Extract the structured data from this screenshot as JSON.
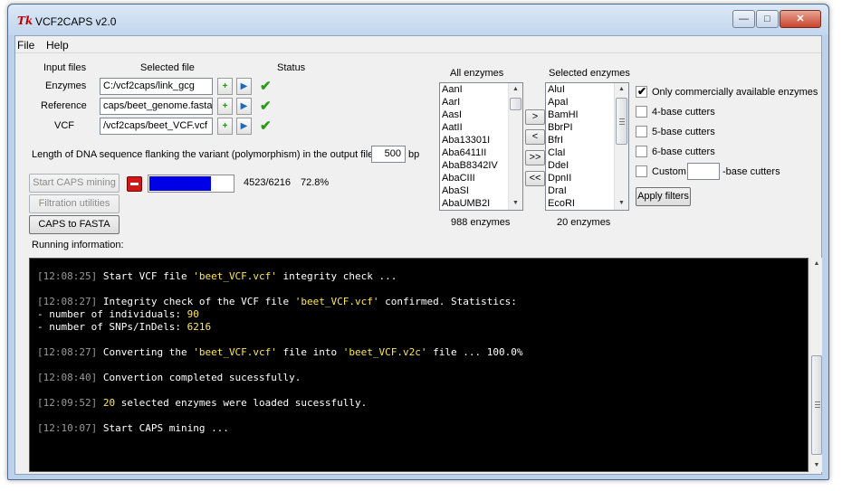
{
  "window": {
    "title": "VCF2CAPS v2.0",
    "icon": "tk-feather-icon",
    "controls": {
      "minimize": "minimize-icon",
      "maximize": "maximize-icon",
      "close": "close-icon"
    }
  },
  "menu": [
    "File",
    "Help"
  ],
  "files": {
    "header_input": "Input files",
    "header_selected": "Selected file",
    "header_status": "Status",
    "rows": [
      {
        "label": "Enzymes",
        "value": "C:/vcf2caps/link_gcg",
        "status": "check-icon"
      },
      {
        "label": "Reference",
        "value": "caps/beet_genome.fasta",
        "status": "check-icon"
      },
      {
        "label": "VCF",
        "value": "/vcf2caps/beet_VCF.vcf",
        "status": "check-icon"
      }
    ]
  },
  "flanking": {
    "label": "Length of DNA sequence flanking the variant (polymorphism) in the output file:",
    "value": "500",
    "unit": "bp"
  },
  "actions": {
    "start": "Start CAPS mining",
    "filtration": "Filtration utilities",
    "to_fasta": "CAPS to FASTA"
  },
  "progress": {
    "fraction": 0.728,
    "count_text": "4523/6216",
    "percent_text": "72.8%"
  },
  "running_info_label": "Running information:",
  "all_enzymes": {
    "header": "All enzymes",
    "items": [
      "AanI",
      "AarI",
      "AasI",
      "AatII",
      "Aba13301I",
      "Aba6411II",
      "AbaB8342IV",
      "AbaCIII",
      "AbaSI",
      "AbaUMB2I"
    ],
    "count_text": "988 enzymes"
  },
  "selected_enzymes": {
    "header": "Selected enzymes",
    "items": [
      "AluI",
      "ApaI",
      "BamHI",
      "BbrPI",
      "BfrI",
      "ClaI",
      "DdeI",
      "DpnII",
      "DraI",
      "EcoRI"
    ],
    "count_text": "20 enzymes"
  },
  "transfer_buttons": [
    ">",
    "<",
    ">>",
    "<<"
  ],
  "filters": {
    "options": [
      {
        "label": "Only commercially available enzymes",
        "checked": true
      },
      {
        "label": "4-base cutters",
        "checked": false
      },
      {
        "label": "5-base cutters",
        "checked": false
      },
      {
        "label": "6-base cutters",
        "checked": false
      }
    ],
    "custom": {
      "label": "Custom",
      "suffix": "-base cutters",
      "value": "",
      "checked": false
    },
    "apply": "Apply filters"
  },
  "log": [
    {
      "ts": "[12:08:25]",
      "parts": [
        [
          "txt",
          " Start VCF file "
        ],
        [
          "hl",
          "'beet_VCF.vcf'"
        ],
        [
          "txt",
          " integrity check ..."
        ]
      ]
    },
    {
      "ts": "[12:08:27]",
      "parts": [
        [
          "txt",
          " Integrity check of the VCF file "
        ],
        [
          "hl",
          "'beet_VCF.vcf'"
        ],
        [
          "txt",
          " confirmed. Statistics:"
        ]
      ]
    },
    {
      "ts": "",
      "parts": [
        [
          "txt",
          "- number of individuals: "
        ],
        [
          "hl",
          "90"
        ]
      ]
    },
    {
      "ts": "",
      "parts": [
        [
          "txt",
          "- number of SNPs/InDels: "
        ],
        [
          "hl",
          "6216"
        ]
      ]
    },
    {
      "ts": "[12:08:27]",
      "parts": [
        [
          "txt",
          " Converting the "
        ],
        [
          "hl",
          "'beet_VCF.vcf'"
        ],
        [
          "txt",
          " file into "
        ],
        [
          "hl",
          "'beet_VCF.v2c'"
        ],
        [
          "txt",
          " file ... 100.0%"
        ]
      ]
    },
    {
      "ts": "[12:08:40]",
      "parts": [
        [
          "txt",
          " Convertion completed sucessfully."
        ]
      ]
    },
    {
      "ts": "[12:09:52]",
      "parts": [
        [
          "hl",
          " 20"
        ],
        [
          "txt",
          " selected enzymes were loaded sucessfully."
        ]
      ]
    },
    {
      "ts": "[12:10:07]",
      "parts": [
        [
          "txt",
          " Start CAPS mining ..."
        ]
      ]
    }
  ],
  "colors": {
    "progress_fill": "#0000e6",
    "console_bg": "#000000",
    "highlight": "#ffe84a",
    "timestamp": "#9a9a9a"
  }
}
